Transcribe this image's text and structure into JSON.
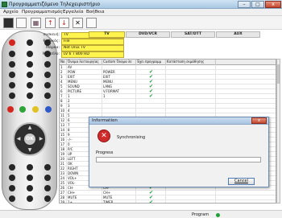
{
  "window": {
    "title": "Προγραμματιζόμενο Τηλεχειριστήριο",
    "minimize": "–",
    "maximize": "□",
    "close": "x"
  },
  "menu": [
    "Αρχείο",
    "Προγραμματισμός",
    "Εργαλεία",
    "Βοήθεια"
  ],
  "toolbar": {
    "buttons": [
      "",
      "",
      "↑",
      "↓",
      "✕",
      ""
    ]
  },
  "device_info": {
    "fields": [
      {
        "label": "συσκευή:",
        "value": "TV"
      },
      {
        "label": "Κωδικός:",
        "value": "File"
      },
      {
        "label": "Μάρκα:",
        "value": "Net Onix TV"
      },
      {
        "label": "Μοντέλο:",
        "value": "LV 6 T 800 HD"
      }
    ],
    "device_tabs": [
      "TV",
      "DVD/VCR",
      "SAT/DTT",
      "AUX"
    ],
    "active_tab": "TV"
  },
  "grid": {
    "columns": [
      "No",
      "Όνομα λειτουργίας",
      "Custom Όνομα λε",
      "Έχει προγραμμ",
      "Κατάσταση εκμάθησης"
    ],
    "rows": [
      {
        "no": "1",
        "name": "AV",
        "custom": "",
        "programmed": false
      },
      {
        "no": "2",
        "name": "POW",
        "custom": "POWER",
        "programmed": true
      },
      {
        "no": "3",
        "name": "EXIT",
        "custom": "EXIT",
        "programmed": true
      },
      {
        "no": "4",
        "name": "MENU",
        "custom": "MENU",
        "programmed": true
      },
      {
        "no": "5",
        "name": "SOUND",
        "custom": "LANG",
        "programmed": true
      },
      {
        "no": "6",
        "name": "PICTURE",
        "custom": "V.FORMAT",
        "programmed": true
      },
      {
        "no": "7",
        "name": "1",
        "custom": "1",
        "programmed": true
      },
      {
        "no": "8",
        "name": "2",
        "custom": "",
        "programmed": false
      },
      {
        "no": "9",
        "name": "3",
        "custom": "",
        "programmed": false
      },
      {
        "no": "10",
        "name": "4",
        "custom": "",
        "programmed": false
      },
      {
        "no": "11",
        "name": "5",
        "custom": "",
        "programmed": false
      },
      {
        "no": "12",
        "name": "6",
        "custom": "",
        "programmed": false
      },
      {
        "no": "13",
        "name": "7",
        "custom": "",
        "programmed": false
      },
      {
        "no": "14",
        "name": "8",
        "custom": "",
        "programmed": false
      },
      {
        "no": "15",
        "name": "9",
        "custom": "",
        "programmed": false
      },
      {
        "no": "16",
        "name": "-/--",
        "custom": "",
        "programmed": false
      },
      {
        "no": "17",
        "name": "0",
        "custom": "",
        "programmed": false
      },
      {
        "no": "18",
        "name": "P/C",
        "custom": "",
        "programmed": false
      },
      {
        "no": "19",
        "name": "UP",
        "custom": "",
        "programmed": false
      },
      {
        "no": "20",
        "name": "LEFT",
        "custom": "",
        "programmed": false
      },
      {
        "no": "21",
        "name": "OK",
        "custom": "",
        "programmed": false
      },
      {
        "no": "22",
        "name": "RIGHT",
        "custom": "RIGHT",
        "programmed": true
      },
      {
        "no": "23",
        "name": "DOWN",
        "custom": "DOWN",
        "programmed": true
      },
      {
        "no": "24",
        "name": "VOL+",
        "custom": "VOL+",
        "programmed": true
      },
      {
        "no": "25",
        "name": "VOL-",
        "custom": "VOL-",
        "programmed": true
      },
      {
        "no": "26",
        "name": "CH-",
        "custom": "CH-",
        "programmed": true
      },
      {
        "no": "27",
        "name": "CH+",
        "custom": "CH+",
        "programmed": true
      },
      {
        "no": "28",
        "name": "MUTE",
        "custom": "MUTE",
        "programmed": true
      },
      {
        "no": "29",
        "name": "1+",
        "custom": "TIMER",
        "programmed": true
      }
    ]
  },
  "status": {
    "text": "Program"
  },
  "dialog": {
    "title": "Information",
    "close": "x",
    "error_icon": "✕",
    "message": "Synchronising",
    "progress_label": "Progress",
    "progress_value": 0,
    "cancel_label": "Cancel"
  },
  "remote": {
    "ok_label": "OK"
  }
}
